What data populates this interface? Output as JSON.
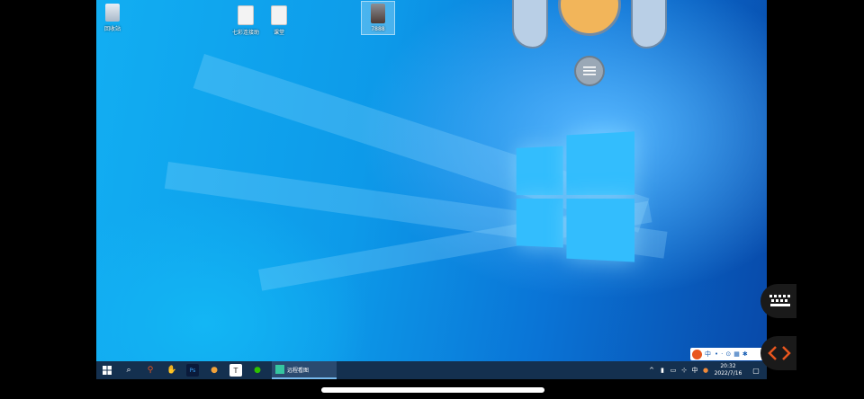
{
  "desktop": {
    "icons": [
      {
        "label": "回收站",
        "icon": "recycle-bin-icon"
      },
      {
        "label": "七彩连接助",
        "icon": "document-icon"
      },
      {
        "label": "课堂",
        "icon": "document-icon"
      },
      {
        "label": "7888",
        "icon": "photo-icon"
      }
    ]
  },
  "taskbar": {
    "active_app_label": "远程看图",
    "time": "20:32",
    "date": "2022/7/16",
    "ime_char": "中"
  },
  "ime_bar": {
    "lang": "中"
  },
  "colors": {
    "wallpaper": "#0d9ae9",
    "taskbar": "#14304f",
    "accent_orange": "#f2b55a"
  }
}
